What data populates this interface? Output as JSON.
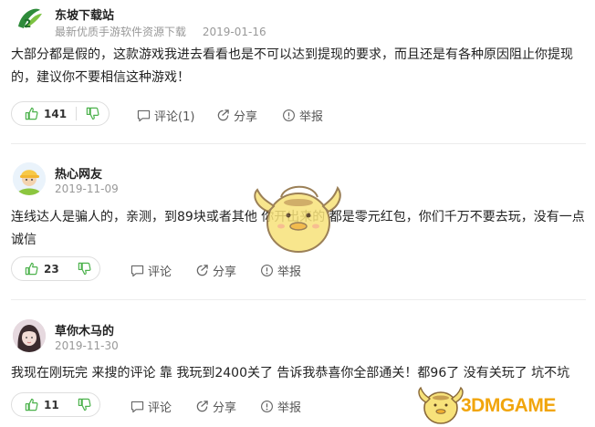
{
  "comments": [
    {
      "author": "东坡下载站",
      "subtitle": "最新优质手游软件资源下载",
      "date": "2019-01-16",
      "text": "大部分都是假的，这款游戏我进去看看也是不可以达到提现的要求，而且还是有各种原因阻止你提现的，建议你不要相信这种游戏！",
      "likes": "141",
      "comment_label": "评论(1)",
      "share_label": "分享",
      "report_label": "举报"
    },
    {
      "author": "热心网友",
      "date": "2019-11-09",
      "text": "连线达人是骗人的，亲测，到89块或者其他 你开出来的 都是零元红包，你们千万不要去玩，没有一点诚信",
      "likes": "23",
      "comment_label": "评论",
      "share_label": "分享",
      "report_label": "举报"
    },
    {
      "author": "草你木马的",
      "date": "2019-11-30",
      "text": "我现在刚玩完 来搜的评论 靠 我玩到2400关了 告诉我恭喜你全部通关！都96了 没有关玩了 坑不坑",
      "likes": "11",
      "comment_label": "评论",
      "share_label": "分享",
      "report_label": "举报"
    }
  ],
  "watermark": {
    "text": "3DMGAME"
  },
  "colors": {
    "like_green": "#4db24d",
    "watermark_orange": "#f1a50c",
    "mascot_yellow": "#f7e27a"
  }
}
